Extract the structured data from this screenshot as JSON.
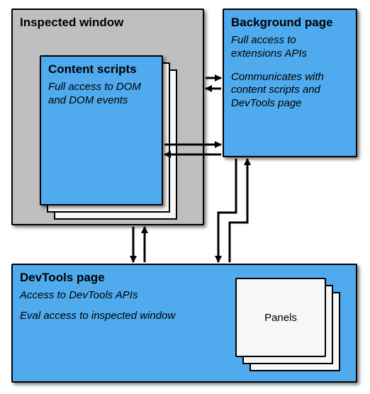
{
  "inspected_window": {
    "title": "Inspected window"
  },
  "content_scripts": {
    "title": "Content scripts",
    "desc": "Full access to DOM and DOM events"
  },
  "background_page": {
    "title": "Background page",
    "desc1": "Full access to extensions APIs",
    "desc2": "Communicates with content scripts and DevTools page"
  },
  "devtools_page": {
    "title": "DevTools page",
    "desc1": "Access to DevTools APIs",
    "desc2": "Eval access to inspected window"
  },
  "panels": {
    "label": "Panels"
  }
}
